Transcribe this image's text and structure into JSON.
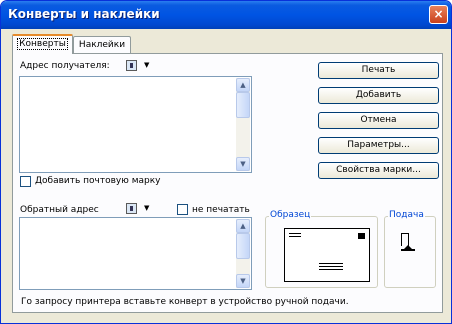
{
  "window": {
    "title": "Конверты и наклейки",
    "close_glyph": "×"
  },
  "tabs": [
    {
      "label": "Конверты",
      "active": true
    },
    {
      "label": "Наклейки",
      "active": false
    }
  ],
  "recipient": {
    "label": "Адрес получателя:",
    "value": ""
  },
  "add_postage": {
    "label": "Добавить почтовую марку",
    "checked": false
  },
  "return_address": {
    "label": "Обратный адрес",
    "value": ""
  },
  "omit": {
    "label": "не печатать",
    "checked": false
  },
  "buttons": {
    "print": "Печать",
    "add": "Добавить",
    "cancel": "Отмена",
    "options": "Параметры...",
    "postage_props": "Свойства марки..."
  },
  "preview": {
    "label": "Образец"
  },
  "feed": {
    "label": "Подача"
  },
  "status_text": "Го запросу принтера вставьте конверт в устройство ручной подачи.",
  "glyphs": {
    "scroll_up": "▲",
    "scroll_down": "▼",
    "dropdown": "▼"
  },
  "icons": [
    "address-book-icon",
    "feed-icon",
    "envelope-preview-icon"
  ]
}
